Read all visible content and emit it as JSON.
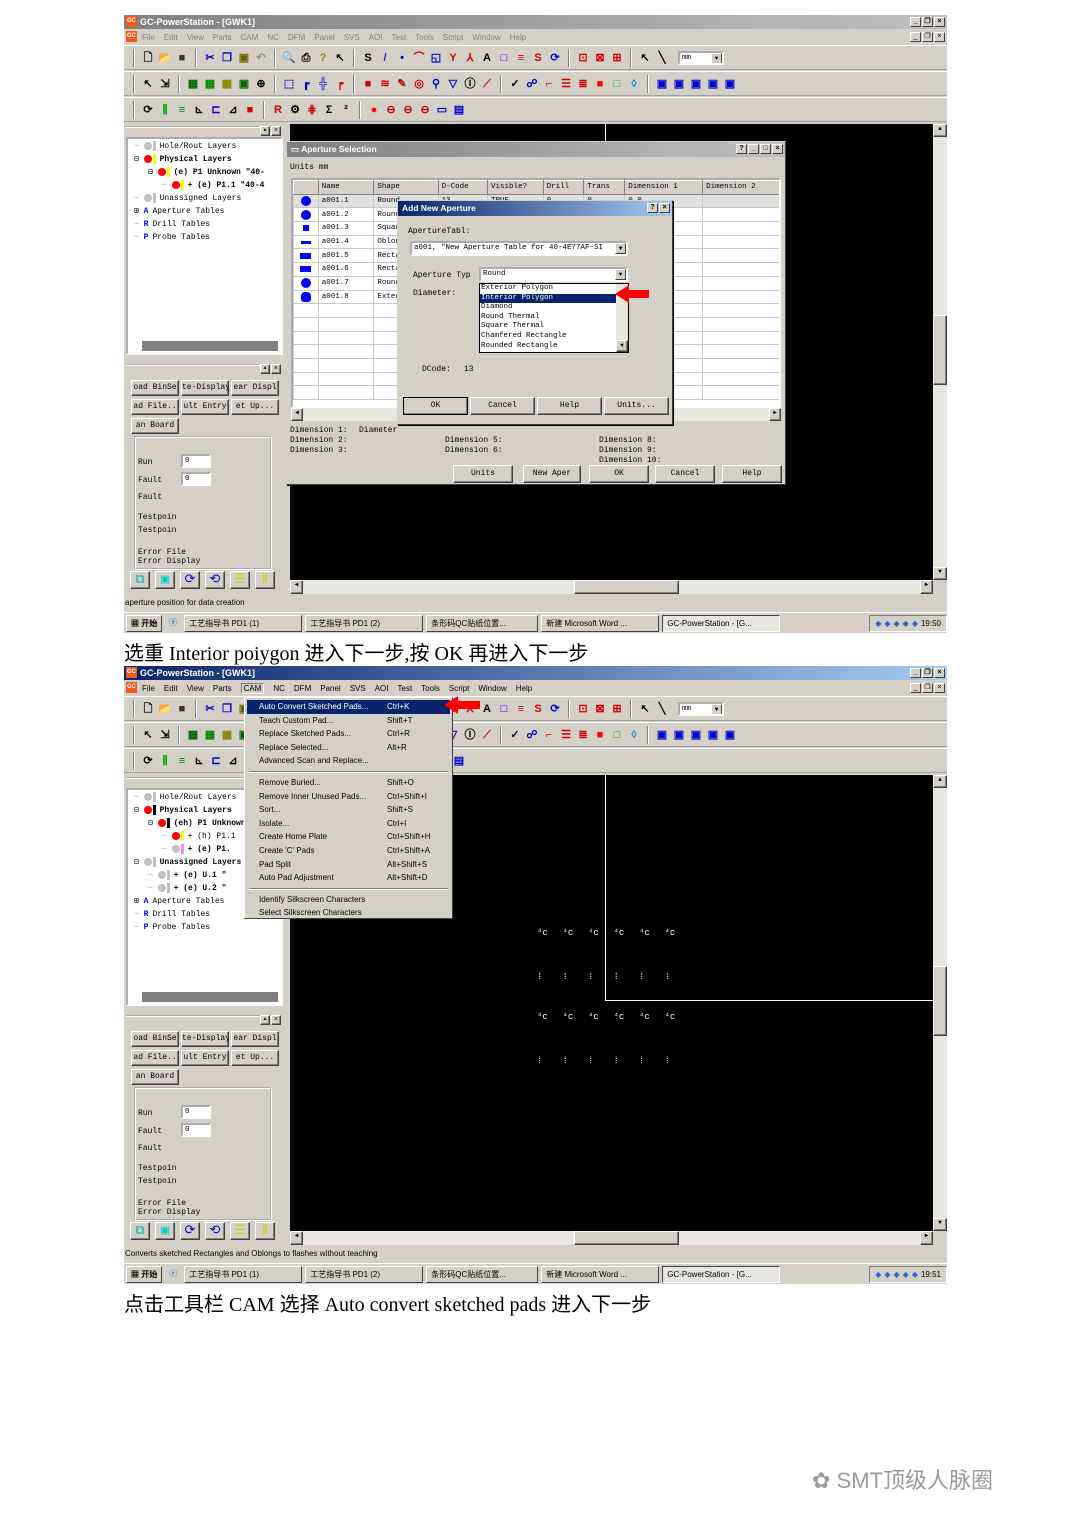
{
  "app_title": "GC-PowerStation - [GWK1]",
  "app_icon_text": "GC",
  "menus": [
    "File",
    "Edit",
    "View",
    "Parts",
    "CAM",
    "NC",
    "DFM",
    "Panel",
    "SVS",
    "AOI",
    "Test",
    "Tools",
    "Script",
    "Window",
    "Help"
  ],
  "toolbar_units": "mm",
  "toolbar_rows": [
    [
      "new-file",
      "open-folder",
      "save",
      "|",
      "cut",
      "copy",
      "paste",
      "undo",
      "|",
      "print-preview",
      "print",
      "help",
      "context-help",
      "|",
      "s-tool",
      "pencil",
      "dots",
      "arc",
      "rect-corner",
      "branch",
      "node",
      "text-a",
      "square-blue",
      "stack",
      "ss",
      "circle-arrow",
      "|",
      "zoom-window",
      "zoom-fit",
      "zoom-all",
      "|",
      "pointer",
      "line-tool"
    ],
    [
      "select-arrow",
      "multi-select",
      "|",
      "grid",
      "grid2",
      "chip",
      "square-green",
      "zoom-pad",
      "|",
      "box-select",
      "corner",
      "route",
      "corner-flag",
      "|",
      "red-square",
      "layers",
      "pencil-red",
      "rings",
      "wand",
      "triangle",
      "ipc",
      "brush",
      "|",
      "check",
      "network",
      "route-red",
      "lines",
      "stack-red",
      "red-fill",
      "green-square",
      "drop",
      "|",
      "win1",
      "win2",
      "win3",
      "win4",
      "win5"
    ],
    [
      "refresh",
      "pins",
      "stack-green",
      "measure",
      "align",
      "chart-line",
      "red-box",
      "|",
      "ref",
      "circle-gear",
      "spread",
      "sigma",
      "sub2",
      "|",
      "red-dot",
      "link1",
      "link2",
      "link3",
      "rect-frame",
      "table"
    ]
  ],
  "left_panel": {
    "test_buttons": [
      "oad BinSe",
      "te-Display",
      "ear Displ",
      "ad File..",
      "ult Entry",
      "et Up...",
      "an Board"
    ],
    "run_label": "Run",
    "run_value": "0",
    "fault_label": "Fault",
    "fault_value": "0",
    "fault2_label": "Fault",
    "testpoint1": "Testpoin",
    "testpoint2": "Testpoin",
    "error_file": "Error File",
    "error_display": "Error Display"
  },
  "taskbar": {
    "start": "开始",
    "items": [
      "工艺指导书 PD1 (1)",
      "工艺指导书 PD1 (2)",
      "条形码QC贴纸位置...",
      "新建 Microsoft Word ...",
      "GC-PowerStation - [G..."
    ]
  },
  "shot1": {
    "tree": [
      {
        "label": "Hole/Rout Layers",
        "dot": "#c0c0c0",
        "bar": "#c0c0c0",
        "bold": false
      },
      {
        "label": "Physical Layers",
        "dot": "#ff0000",
        "bar": "#ffff00",
        "bold": true
      },
      {
        "label": "(e) P1 Unknown \"40-",
        "dot": "#ff0000",
        "bar": "#ffff00",
        "bold": true
      },
      {
        "label": "+ (e) P1.1 \"40-4",
        "dot": "#ff0000",
        "bar": "#ffff00",
        "bold": true
      },
      {
        "label": "Unassigned Layers",
        "dot": "#c0c0c0",
        "bar": "#c0c0c0",
        "bold": false
      },
      {
        "label": "Aperture Tables",
        "icon": "A",
        "bold": false
      },
      {
        "label": "Drill Tables",
        "icon": "R",
        "bold": false
      },
      {
        "label": "Probe Tables",
        "icon": "P",
        "bold": false
      }
    ],
    "status": "aperture position for data creation",
    "clock": "19:50",
    "aperture_dialog": {
      "title": "Aperture Selection",
      "units_label": "Units mm",
      "columns": [
        "",
        "Name",
        "Shape",
        "D-Code",
        "Visible?",
        "Drill",
        "Trans",
        "Dimension 1",
        "Dimension 2",
        "Dimension 3",
        "Dimens"
      ],
      "rows": [
        {
          "shape_icon": "circle",
          "name": "a001.1",
          "shape": "Round",
          "dcode": "13",
          "visible": "TRUE",
          "drill": "0",
          "trans": "0",
          "dim1": "0.0"
        },
        {
          "shape_icon": "circle",
          "name": "a001.2",
          "shape": "Round"
        },
        {
          "shape_icon": "square",
          "name": "a001.3",
          "shape": "Square"
        },
        {
          "shape_icon": "oblong",
          "name": "a001.4",
          "shape": "Oblong"
        },
        {
          "shape_icon": "rect",
          "name": "a001.5",
          "shape": "Rectangl"
        },
        {
          "shape_icon": "rect",
          "name": "a001.6",
          "shape": "Rectangl"
        },
        {
          "shape_icon": "circle",
          "name": "a001.7",
          "shape": "Round"
        },
        {
          "shape_icon": "polygon",
          "name": "a001.8",
          "shape": "Exteri.."
        }
      ],
      "dim_labels_col1": [
        "Dimension 1:",
        "Dimension 2:",
        "Dimension 3:"
      ],
      "dim1_value": "Diameter",
      "dim_labels_col2": [
        "Dimension 5:",
        "Dimension 6:"
      ],
      "dim_labels_col3": [
        "Dimension 8:",
        "Dimension 9:",
        "Dimension 10:"
      ],
      "buttons": [
        "Units",
        "New Aper",
        "OK",
        "Cancel",
        "Help"
      ]
    },
    "add_dialog": {
      "title": "Add New Aperture",
      "table_label": "ApertureTabl:",
      "table_value": "a001, \"New Aperture Table for 40-4E77AF-SI",
      "type_label": "Aperture Typ",
      "type_value": "Round",
      "diameter_label": "Diameter:",
      "type_options": [
        "Exterior Polygon",
        "Interior Polygon",
        "Diamond",
        "Round Thermal",
        "Square Thermal",
        "Chamfered Rectangle",
        "Rounded Rectangle"
      ],
      "selected_option": "Interior Polygon",
      "dcode_label": "DCode:",
      "dcode_value": "13",
      "buttons": [
        "OK",
        "Cancel",
        "Help",
        "Units..."
      ]
    }
  },
  "caption1": "选重 Interior poiygon 进入下一步,按 OK 再进入下一步",
  "shot2": {
    "active_menu": "CAM",
    "tree": [
      {
        "label": "Hole/Rout Layers",
        "dot": "#c0c0c0",
        "bar": "#c0c0c0",
        "bold": false,
        "indent": 0
      },
      {
        "label": "Physical Layers",
        "dot": "#ff0000",
        "bar": "#000000",
        "bold": true,
        "indent": 0
      },
      {
        "label": "(eh) P1 Unknown",
        "dot": "#ff0000",
        "bar": "#000000",
        "bold": true,
        "indent": 1
      },
      {
        "label": "+ (h) P1.1",
        "dot": "#ff0000",
        "bar": "#ffff00",
        "bold": false,
        "indent": 2
      },
      {
        "label": "+ (e) P1.",
        "dot": "#c0c0c0",
        "bar": "#ff80ff",
        "bold": true,
        "indent": 2
      },
      {
        "label": "Unassigned Layers",
        "dot": "#c0c0c0",
        "bar": "#c0c0c0",
        "bold": true,
        "indent": 0
      },
      {
        "label": "+ (e) U.1 \"",
        "dot": "#c0c0c0",
        "bar": "#c0c0c0",
        "bold": true,
        "indent": 1
      },
      {
        "label": "+ (e) U.2 \"",
        "dot": "#c0c0c0",
        "bar": "#c0c0c0",
        "bold": true,
        "indent": 1
      },
      {
        "label": "Aperture Tables",
        "icon": "A",
        "bold": false,
        "indent": 0
      },
      {
        "label": "Drill Tables",
        "icon": "R",
        "bold": false,
        "indent": 0
      },
      {
        "label": "Probe Tables",
        "icon": "P",
        "bold": false,
        "indent": 0
      }
    ],
    "cam_menu": [
      {
        "label": "Auto Convert Sketched Pads...",
        "shortcut": "Ctrl+K",
        "highlighted": true
      },
      {
        "label": "Teach Custom Pad...",
        "shortcut": "Shift+T"
      },
      {
        "label": "Replace Sketched Pads...",
        "shortcut": "Ctrl+R"
      },
      {
        "label": "Replace Selected...",
        "shortcut": "Alt+R"
      },
      {
        "label": "Advanced Scan and Replace...",
        "shortcut": ""
      },
      {
        "separator": true
      },
      {
        "label": "Remove Buried...",
        "shortcut": "Shift+O"
      },
      {
        "label": "Remove Inner Unused Pads...",
        "shortcut": "Ctrl+Shift+I"
      },
      {
        "label": "Sort...",
        "shortcut": "Shift+S"
      },
      {
        "label": "Isolate...",
        "shortcut": "Ctrl+I"
      },
      {
        "label": "Create Home Plate",
        "shortcut": "Ctrl+Shift+H"
      },
      {
        "label": "Create 'C' Pads",
        "shortcut": "Ctrl+Shift+A"
      },
      {
        "label": "Pad Split",
        "shortcut": "Alt+Shift+S"
      },
      {
        "label": "Auto Pad Adjustment",
        "shortcut": "Alt+Shift+D"
      },
      {
        "separator": true
      },
      {
        "label": "Identify Silkscreen Characters",
        "shortcut": ""
      },
      {
        "label": "Select Silkscreen Characters",
        "shortcut": ""
      }
    ],
    "status": "Converts sketched Rectangles and Oblongs to flashes without teaching",
    "clock": "19:51"
  },
  "caption2": "点击工具栏 CAM 选择  Auto convert sketched pads 进入下一步",
  "watermark": "SMT顶级人脉圈",
  "colors": {
    "accent_red": "#ff0000",
    "selection": "#0a246a",
    "aperture_blue": "#0000ff"
  }
}
